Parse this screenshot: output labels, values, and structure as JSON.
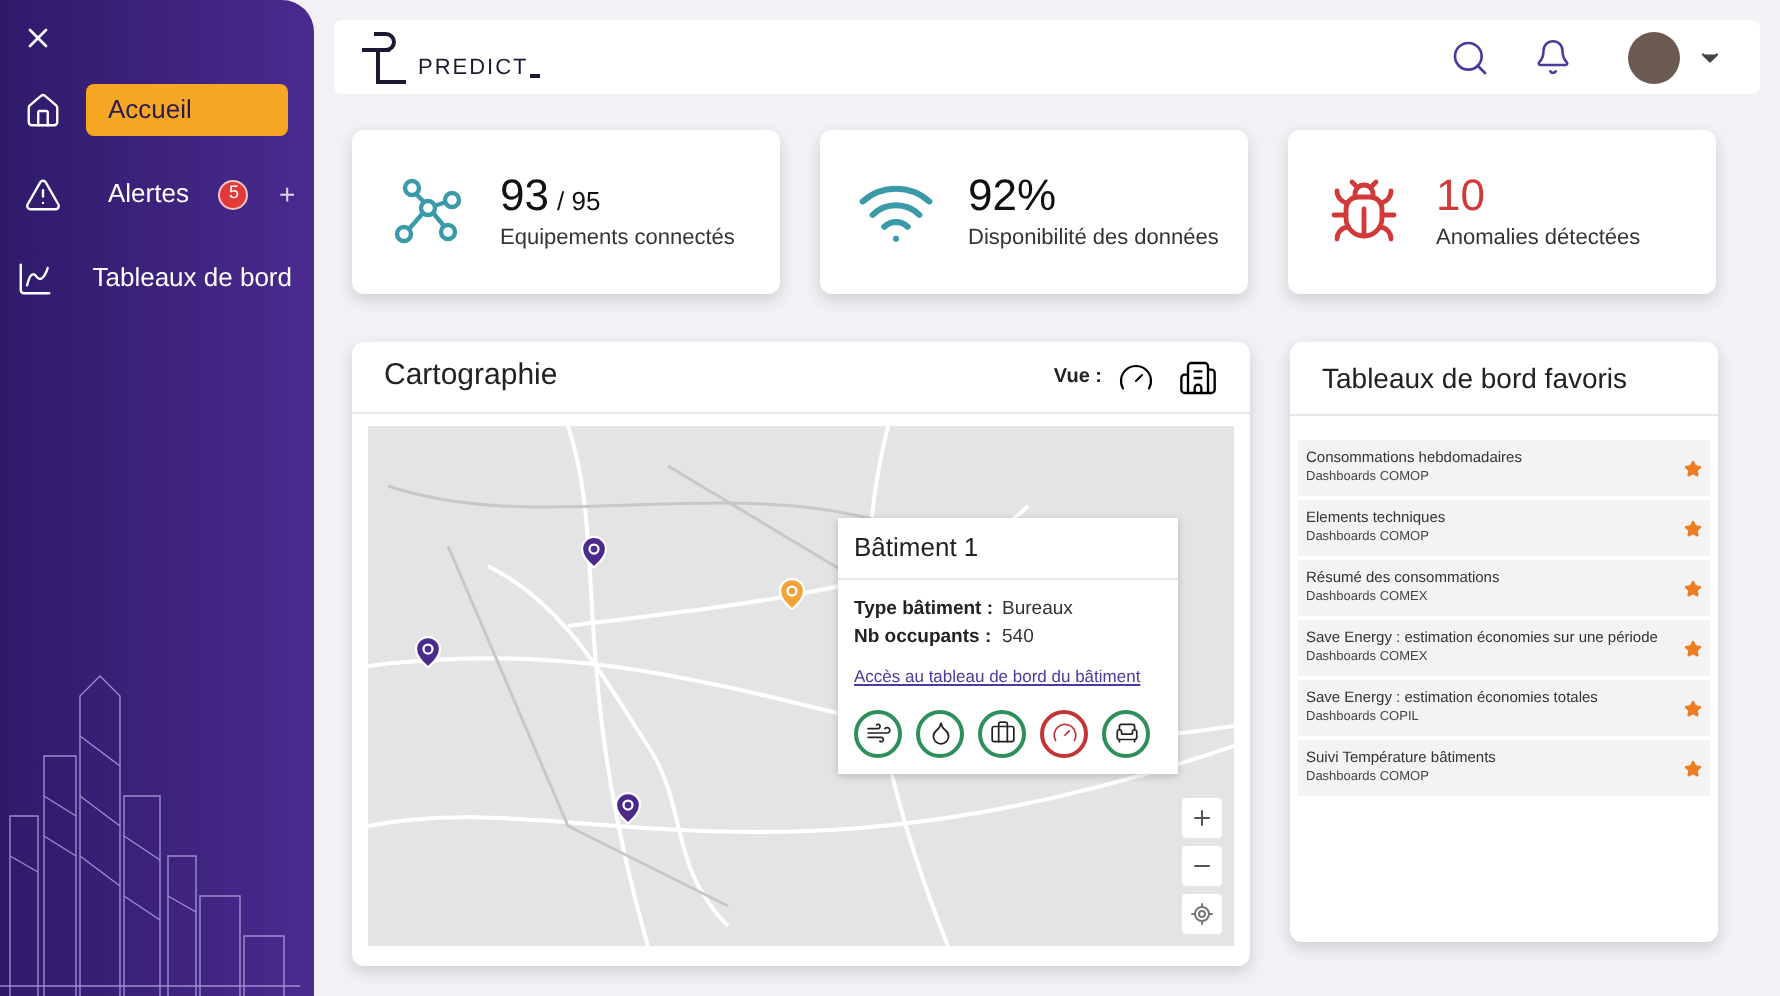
{
  "sidebar": {
    "items": [
      {
        "kind": "home",
        "label": "Accueil",
        "selected": true
      },
      {
        "kind": "alert",
        "label": "Alertes",
        "badge": "5",
        "add": "+",
        "selected": false
      },
      {
        "kind": "chart",
        "label": "Tableaux de bord",
        "selected": false
      }
    ]
  },
  "header": {
    "logo": "PREDICT"
  },
  "stats": [
    {
      "kind": "network",
      "value": "93",
      "total": "/ 95",
      "label": "Equipements connectés",
      "color": "#3a9aa8"
    },
    {
      "kind": "wifi",
      "value": "92%",
      "label": "Disponibilité des données",
      "color": "#3a9aa8"
    },
    {
      "kind": "bug",
      "value": "10",
      "label": "Anomalies détectées",
      "color": "#d23a3a"
    }
  ],
  "map": {
    "title": "Cartographie",
    "view_label": "Vue :",
    "markers": [
      {
        "color": "#4b2a8c"
      },
      {
        "color": "#4b2a8c"
      },
      {
        "color": "#4b2a8c"
      },
      {
        "color": "#f2a33a"
      }
    ],
    "popup": {
      "title": "Bâtiment 1",
      "fields": [
        {
          "label": "Type bâtiment :",
          "value": "Bureaux"
        },
        {
          "label": "Nb occupants :",
          "value": "540"
        }
      ],
      "link": "Accès au tableau de bord du bâtiment",
      "statuses": [
        {
          "kind": "wind",
          "color": "#2e8f5a"
        },
        {
          "kind": "water",
          "color": "#2e8f5a"
        },
        {
          "kind": "case",
          "color": "#2e8f5a"
        },
        {
          "kind": "gauge",
          "color": "#c23535"
        },
        {
          "kind": "chair",
          "color": "#2e8f5a"
        }
      ]
    }
  },
  "favorites": {
    "title": "Tableaux de bord favoris",
    "items": [
      {
        "title": "Consommations hebdomadaires",
        "subtitle": "Dashboards COMOP",
        "starred": true
      },
      {
        "title": "Elements techniques",
        "subtitle": "Dashboards COMOP",
        "starred": true
      },
      {
        "title": "Résumé des consommations",
        "subtitle": "Dashboards COMEX",
        "starred": true
      },
      {
        "title": "Save Energy : estimation économies sur une période",
        "subtitle": "Dashboards COMEX",
        "starred": true
      },
      {
        "title": "Save Energy : estimation économies totales",
        "subtitle": "Dashboards COPIL",
        "starred": true
      },
      {
        "title": "Suivi Température bâtiments",
        "subtitle": "Dashboards COMOP",
        "starred": true
      }
    ]
  }
}
